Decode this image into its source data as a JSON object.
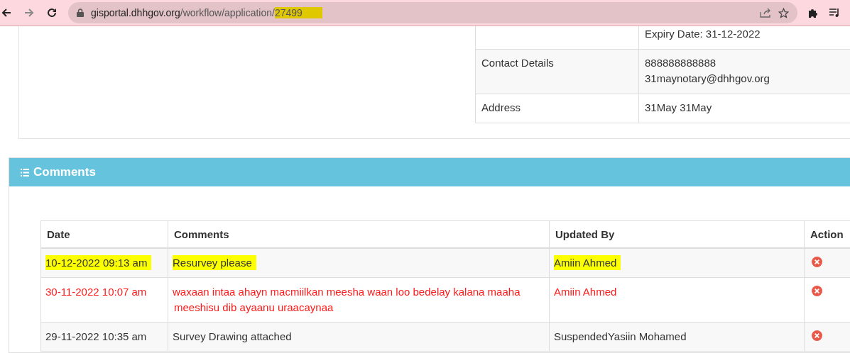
{
  "browser": {
    "url_host": "gisportal.dhhgov.org",
    "url_path": "/workflow/application/",
    "url_id": "27499",
    "url_id_highlighted": true
  },
  "details": {
    "rows": [
      {
        "label": "",
        "value": [
          "Expiry Date: 31-12-2022"
        ]
      },
      {
        "label": "Contact Details",
        "value": [
          "888888888888",
          "31maynotary@dhhgov.org"
        ]
      },
      {
        "label": "Address",
        "value": [
          "31May 31May"
        ]
      }
    ]
  },
  "comments": {
    "title": "Comments",
    "columns": [
      "Date",
      "Comments",
      "Updated By",
      "Action"
    ],
    "rows": [
      {
        "date": "10-12-2022 09:13 am",
        "comment": "Resurvey please",
        "updated_by": "Amiin Ahmed",
        "color": "#333333",
        "highlighted": true
      },
      {
        "date": "30-11-2022 10:07 am",
        "comment": "waxaan intaa ahayn macmiilkan meesha waan loo bedelay kalana maaha meeshisu dib ayaanu uraacaynaa",
        "updated_by": "Amiin Ahmed",
        "color": "#ff1a1a",
        "highlighted": false
      },
      {
        "date": "29-11-2022 10:35 am",
        "comment": "Survey Drawing attached",
        "updated_by": "SuspendedYasiin Mohamed",
        "color": "#333333",
        "highlighted": false
      }
    ]
  }
}
